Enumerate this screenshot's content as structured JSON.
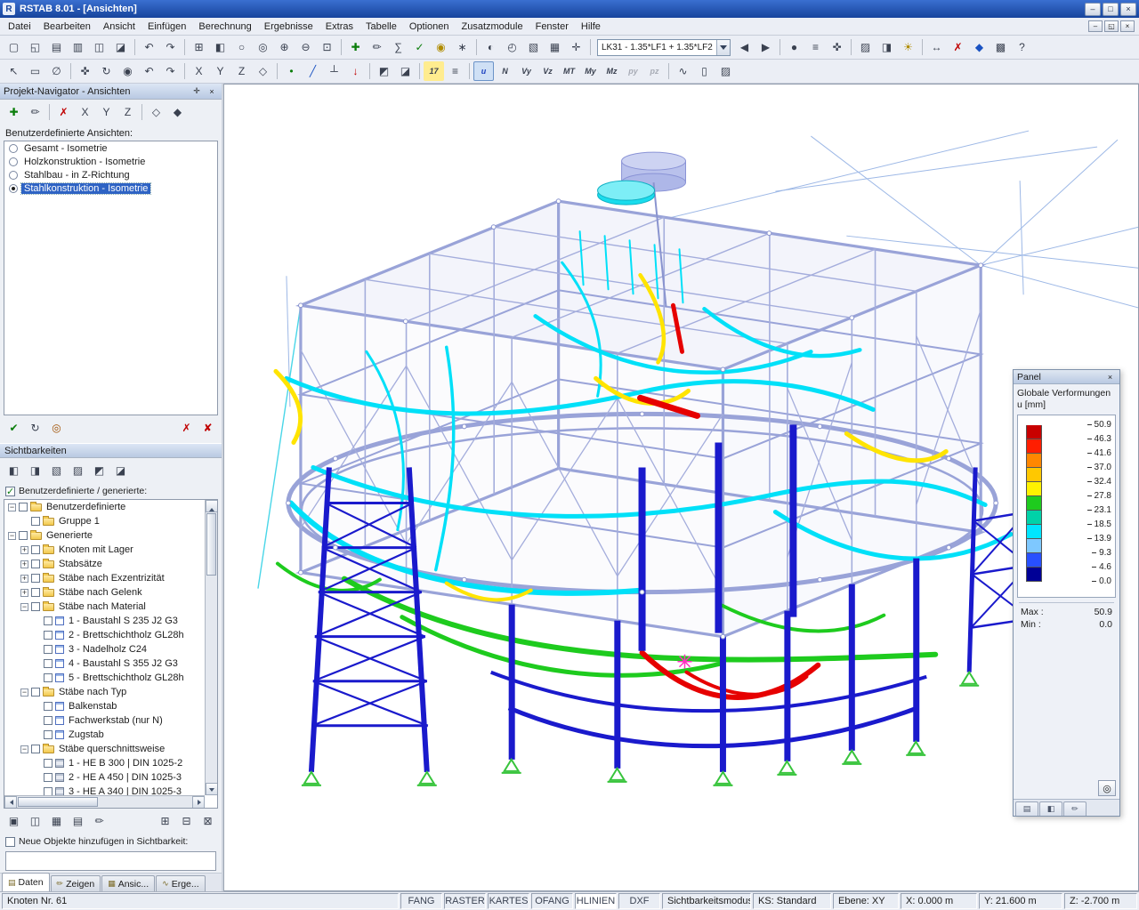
{
  "window": {
    "title": "RSTAB 8.01 - [Ansichten]",
    "app_icon": "R",
    "controls": [
      {
        "name": "minimize-button",
        "glyph": "–"
      },
      {
        "name": "maximize-button",
        "glyph": "□"
      },
      {
        "name": "close-button",
        "glyph": "×"
      }
    ]
  },
  "menu": {
    "items": [
      "Datei",
      "Bearbeiten",
      "Ansicht",
      "Einfügen",
      "Berechnung",
      "Ergebnisse",
      "Extras",
      "Tabelle",
      "Optionen",
      "Zusatzmodule",
      "Fenster",
      "Hilfe"
    ],
    "mdi_controls": [
      {
        "name": "mdi-minimize-button",
        "glyph": "–"
      },
      {
        "name": "mdi-restore-button",
        "glyph": "◱"
      },
      {
        "name": "mdi-close-button",
        "glyph": "×"
      }
    ]
  },
  "toolbar": {
    "load_case": "LK31 - 1.35*LF1 + 1.35*LF2",
    "row1a": [
      {
        "name": "new-file-button",
        "glyph": "▢"
      },
      {
        "name": "open-file-button",
        "glyph": "◱"
      },
      {
        "name": "save-file-button",
        "glyph": "▤"
      },
      {
        "name": "print-button",
        "glyph": "▥"
      },
      {
        "name": "print-preview-button",
        "glyph": "◫"
      },
      {
        "name": "copy-graphic-button",
        "glyph": "◪"
      },
      {
        "sep": true
      },
      {
        "name": "undo-button",
        "glyph": "↶"
      },
      {
        "name": "redo-button",
        "glyph": "↷"
      },
      {
        "sep": true
      },
      {
        "name": "open-tables-button",
        "glyph": "⊞"
      },
      {
        "name": "project-navigator-button",
        "glyph": "◧"
      },
      {
        "name": "find-object-button",
        "glyph": "○"
      },
      {
        "name": "zoom-window-button",
        "glyph": "◎"
      },
      {
        "name": "zoom-in-button",
        "glyph": "⊕"
      },
      {
        "name": "zoom-out-button",
        "glyph": "⊖"
      },
      {
        "name": "show-all-button",
        "glyph": "⊡"
      },
      {
        "sep": true
      },
      {
        "name": "new-load-case-button",
        "glyph": "✚",
        "tint": "#0a7d0a"
      },
      {
        "name": "edit-load-case-button",
        "glyph": "✏"
      },
      {
        "name": "calculate-button",
        "glyph": "∑"
      },
      {
        "name": "check-model-button",
        "glyph": "✓",
        "tint": "#0a7d0a"
      },
      {
        "name": "show-results-button",
        "glyph": "◉",
        "tint": "#b08c00"
      },
      {
        "name": "result-values-button",
        "glyph": "∗"
      },
      {
        "sep": true
      },
      {
        "name": "camera-button",
        "glyph": "◐"
      },
      {
        "name": "standard-views-button",
        "glyph": "◴"
      },
      {
        "name": "work-plane-button",
        "glyph": "▧"
      },
      {
        "name": "grid-settings-button",
        "glyph": "▦"
      },
      {
        "name": "snap-button",
        "glyph": "✛"
      },
      {
        "sep": true
      }
    ],
    "row1b": [
      {
        "name": "previous-load-case-button",
        "glyph": "◀"
      },
      {
        "name": "next-load-case-button",
        "glyph": "▶"
      },
      {
        "sep": true
      },
      {
        "name": "goto-load-case-button",
        "glyph": "●"
      },
      {
        "name": "superposition-button",
        "glyph": "≡"
      },
      {
        "name": "xyz-coordinates-button",
        "glyph": "✜"
      },
      {
        "sep": true
      },
      {
        "name": "display-properties-button",
        "glyph": "▨"
      },
      {
        "name": "render-mode-button",
        "glyph": "◨"
      },
      {
        "name": "lighting-button",
        "glyph": "☀",
        "tint": "#b08c00"
      },
      {
        "sep": true
      },
      {
        "name": "measure-button",
        "glyph": "↔"
      },
      {
        "name": "delete-results-button",
        "glyph": "✗",
        "tint": "#c00000"
      },
      {
        "name": "modules-button",
        "glyph": "◆",
        "tint": "#1a52c2"
      },
      {
        "name": "screenshot-button",
        "glyph": "▩"
      },
      {
        "name": "help-button",
        "glyph": "?"
      }
    ],
    "row2": [
      {
        "name": "select-pointer-button",
        "glyph": "↖"
      },
      {
        "name": "select-window-button",
        "glyph": "▭"
      },
      {
        "name": "select-special-button",
        "glyph": "∅"
      },
      {
        "sep": true
      },
      {
        "name": "move-view-button",
        "glyph": "✜"
      },
      {
        "name": "rotate-view-button",
        "glyph": "↻"
      },
      {
        "name": "zoom-dynamic-button",
        "glyph": "◉"
      },
      {
        "name": "previous-view-button",
        "glyph": "↶"
      },
      {
        "name": "next-view-button",
        "glyph": "↷"
      },
      {
        "sep": true
      },
      {
        "name": "view-in-x-button",
        "glyph": "X"
      },
      {
        "name": "view-in-y-button",
        "glyph": "Y"
      },
      {
        "name": "view-in-z-button",
        "glyph": "Z"
      },
      {
        "name": "isometric-view-button",
        "glyph": "◇"
      },
      {
        "sep": true
      },
      {
        "name": "new-node-button",
        "glyph": "•",
        "tint": "#0a7d0a"
      },
      {
        "name": "new-member-button",
        "glyph": "╱",
        "tint": "#1a52c2"
      },
      {
        "name": "new-support-button",
        "glyph": "┴"
      },
      {
        "name": "new-load-button",
        "glyph": "↓",
        "tint": "#c00000"
      },
      {
        "sep": true
      },
      {
        "name": "visibility-mode-button",
        "glyph": "◩"
      },
      {
        "name": "clipping-plane-button",
        "glyph": "◪"
      },
      {
        "sep": true
      },
      {
        "name": "load-case-display-button",
        "glyph": "17",
        "bg": "#ffec8f",
        "small": true
      },
      {
        "name": "show-values-button",
        "glyph": "≡"
      },
      {
        "sep": true
      },
      {
        "name": "deformation-toggle",
        "glyph": "u",
        "small": true,
        "active": true,
        "tint": "#1a3fbf"
      },
      {
        "name": "normal-force-toggle",
        "glyph": "N",
        "small": true
      },
      {
        "name": "shear-vy-toggle",
        "glyph": "Vy",
        "small": true
      },
      {
        "name": "shear-vz-toggle",
        "glyph": "Vz",
        "small": true
      },
      {
        "name": "torsion-mt-toggle",
        "glyph": "MT",
        "small": true
      },
      {
        "name": "moment-my-toggle",
        "glyph": "My",
        "small": true
      },
      {
        "name": "moment-mz-toggle",
        "glyph": "Mz",
        "small": true
      },
      {
        "name": "load-py-toggle",
        "glyph": "py",
        "small": true,
        "disabled": true
      },
      {
        "name": "load-pz-toggle",
        "glyph": "pz",
        "small": true,
        "disabled": true
      },
      {
        "sep": true
      },
      {
        "name": "result-diagrams-button",
        "glyph": "∿"
      },
      {
        "name": "panel-toggle-button",
        "glyph": "▯"
      },
      {
        "name": "print-graphic-button",
        "glyph": "▨"
      }
    ]
  },
  "navigator": {
    "title": "Projekt-Navigator - Ansichten",
    "pin_glyph": "✛",
    "close_glyph": "×",
    "toolbar_top": [
      {
        "name": "navigator-new-view-button",
        "glyph": "✚",
        "tint": "#0a7d0a"
      },
      {
        "name": "navigator-edit-view-button",
        "glyph": "✏"
      },
      {
        "sep": true
      },
      {
        "name": "navigator-delete-view-button",
        "glyph": "✗",
        "tint": "#c00000"
      },
      {
        "name": "navigator-view-x-button",
        "glyph": "X"
      },
      {
        "name": "navigator-view-y-button",
        "glyph": "Y"
      },
      {
        "name": "navigator-view-z-button",
        "glyph": "Z"
      },
      {
        "sep": true
      },
      {
        "name": "navigator-view-isometric-button",
        "glyph": "◇"
      },
      {
        "name": "navigator-view-perspective-button",
        "glyph": "◆"
      }
    ],
    "views_label": "Benutzerdefinierte Ansichten:",
    "views": [
      {
        "label": "Gesamt - Isometrie",
        "selected": false
      },
      {
        "label": "Holzkonstruktion - Isometrie",
        "selected": false
      },
      {
        "label": "Stahlbau - in Z-Richtung",
        "selected": false
      },
      {
        "label": "Stahlkonstruktion - Isometrie",
        "selected": true
      }
    ],
    "toolbar_mid_left": [
      {
        "name": "show-view-button",
        "glyph": "✔",
        "tint": "#0a7d0a"
      },
      {
        "name": "refresh-view-button",
        "glyph": "↻"
      },
      {
        "name": "view-settings-button",
        "glyph": "◎",
        "tint": "#a05000"
      }
    ],
    "toolbar_mid_right": [
      {
        "name": "delete-visibility-button",
        "glyph": "✗",
        "tint": "#c00000"
      },
      {
        "name": "delete-all-visibilities-button",
        "glyph": "✘",
        "tint": "#c00000"
      }
    ],
    "visibilities_title": "Sichtbarkeiten",
    "toolbar_vis": [
      {
        "name": "visibility-by-window-button",
        "glyph": "◧"
      },
      {
        "name": "visibility-invert-button",
        "glyph": "◨"
      },
      {
        "name": "visibility-by-object-button",
        "glyph": "▧"
      },
      {
        "name": "visibility-numbering-button",
        "glyph": "▨"
      },
      {
        "name": "visibility-lock-button",
        "glyph": "◩"
      },
      {
        "name": "visibility-reset-button",
        "glyph": "◪"
      }
    ],
    "generated_label": "Benutzerdefinierte / generierte:",
    "generated_state": "checked",
    "tree": [
      {
        "label": "Benutzerdefinierte",
        "level": 0,
        "expander": "minus",
        "checkbox": "unchecked",
        "icon": "folder"
      },
      {
        "label": "Gruppe 1",
        "level": 1,
        "expander": "none",
        "checkbox": "unchecked",
        "icon": "folder"
      },
      {
        "label": "Generierte",
        "level": 0,
        "expander": "minus",
        "checkbox": "unchecked",
        "icon": "folder"
      },
      {
        "label": "Knoten mit Lager",
        "level": 1,
        "expander": "plus",
        "checkbox": "unchecked",
        "icon": "folder"
      },
      {
        "label": "Stabsätze",
        "level": 1,
        "expander": "plus",
        "checkbox": "unchecked",
        "icon": "folder"
      },
      {
        "label": "Stäbe nach Exzentrizität",
        "level": 1,
        "expander": "plus",
        "checkbox": "unchecked",
        "icon": "folder"
      },
      {
        "label": "Stäbe nach Gelenk",
        "level": 1,
        "expander": "plus",
        "checkbox": "unchecked",
        "icon": "folder"
      },
      {
        "label": "Stäbe nach Material",
        "level": 1,
        "expander": "minus",
        "checkbox": "checked",
        "icon": "folder"
      },
      {
        "label": "1 - Baustahl S 235 J2 G3",
        "level": 2,
        "expander": "none",
        "checkbox": "checked",
        "icon": "mat"
      },
      {
        "label": "2 - Brettschichtholz GL28h",
        "level": 2,
        "expander": "none",
        "checkbox": "unchecked",
        "icon": "mat"
      },
      {
        "label": "3 - Nadelholz C24",
        "level": 2,
        "expander": "none",
        "checkbox": "unchecked",
        "icon": "mat"
      },
      {
        "label": "4 - Baustahl S 355 J2 G3",
        "level": 2,
        "expander": "none",
        "checkbox": "checked",
        "icon": "mat"
      },
      {
        "label": "5 - Brettschichtholz GL28h",
        "level": 2,
        "expander": "none",
        "checkbox": "unchecked",
        "icon": "mat"
      },
      {
        "label": "Stäbe nach Typ",
        "level": 1,
        "expander": "minus",
        "checkbox": "unchecked",
        "icon": "folder"
      },
      {
        "label": "Balkenstab",
        "level": 2,
        "expander": "none",
        "checkbox": "unchecked",
        "icon": "mat"
      },
      {
        "label": "Fachwerkstab (nur N)",
        "level": 2,
        "expander": "none",
        "checkbox": "unchecked",
        "icon": "mat"
      },
      {
        "label": "Zugstab",
        "level": 2,
        "expander": "none",
        "checkbox": "unchecked",
        "icon": "mat"
      },
      {
        "label": "Stäbe querschnittsweise",
        "level": 1,
        "expander": "minus",
        "checkbox": "unchecked",
        "icon": "folder"
      },
      {
        "label": "1 - HE B 300 | DIN 1025-2",
        "level": 2,
        "expander": "none",
        "checkbox": "unchecked",
        "icon": "section"
      },
      {
        "label": "2 - HE A 450 | DIN 1025-3",
        "level": 2,
        "expander": "none",
        "checkbox": "unchecked",
        "icon": "section"
      },
      {
        "label": "3 - HE A 340 | DIN 1025-3",
        "level": 2,
        "expander": "none",
        "checkbox": "unchecked",
        "icon": "section"
      }
    ],
    "toolbar_bottom_left": [
      {
        "name": "user-defined-visibility-button",
        "glyph": "▣"
      },
      {
        "name": "invert-selection-button",
        "glyph": "◫"
      },
      {
        "name": "intersection-mode-button",
        "glyph": "▦"
      },
      {
        "name": "union-mode-button",
        "glyph": "▤"
      },
      {
        "name": "edit-visibility-button",
        "glyph": "✏"
      }
    ],
    "toolbar_bottom_right": [
      {
        "name": "show-table-button",
        "glyph": "⊞"
      },
      {
        "name": "sync-table-button",
        "glyph": "⊟"
      },
      {
        "name": "table-settings-button",
        "glyph": "⊠"
      }
    ],
    "new_objects_label": "Neue Objekte hinzufügen in Sichtbarkeit:",
    "new_objects_state": "unchecked",
    "tabs": [
      {
        "label": "Daten",
        "glyph": "▤",
        "active": true
      },
      {
        "label": "Zeigen",
        "glyph": "✏",
        "active": false
      },
      {
        "label": "Ansic...",
        "glyph": "▦",
        "active": false
      },
      {
        "label": "Erge...",
        "glyph": "∿",
        "active": false
      }
    ]
  },
  "panel": {
    "title": "Panel",
    "close_glyph": "×",
    "heading_line1": "Globale Verformungen",
    "heading_line2": "u [mm]",
    "scale_labels": [
      "50.9",
      "46.3",
      "41.6",
      "37.0",
      "32.4",
      "27.8",
      "23.1",
      "18.5",
      "13.9",
      "9.3",
      "4.6",
      "0.0"
    ],
    "scale_colors": [
      "#c80000",
      "#ff1e00",
      "#ff8700",
      "#ffc800",
      "#fff200",
      "#1ecb1e",
      "#00d2a8",
      "#00e5ff",
      "#7ec8ff",
      "#2850ff",
      "#000096"
    ],
    "max_label": "Max :",
    "max_value": "50.9",
    "min_label": "Min :",
    "min_value": "0.0",
    "zoom_glyph": "◎",
    "tabs": [
      {
        "name": "panel-tab-color-scale",
        "glyph": "▤"
      },
      {
        "name": "panel-tab-factors",
        "glyph": "◧"
      },
      {
        "name": "panel-tab-filter",
        "glyph": "✏"
      }
    ]
  },
  "statusbar": {
    "node_info": "Knoten Nr. 61",
    "toggles": [
      {
        "label": "FANG",
        "active": false
      },
      {
        "label": "RASTER",
        "active": false
      },
      {
        "label": "KARTES",
        "active": false
      },
      {
        "label": "OFANG",
        "active": false
      },
      {
        "label": "HLINIEN",
        "active": true
      },
      {
        "label": "DXF",
        "active": false
      }
    ],
    "mode_label": "Sichtbarkeitsmodus",
    "mode_value": "KS: Standard",
    "plane": "Ebene: XY",
    "coord_x": "X:  0.000 m",
    "coord_y": "Y:  21.600 m",
    "coord_z": "Z:  -2.700 m"
  }
}
